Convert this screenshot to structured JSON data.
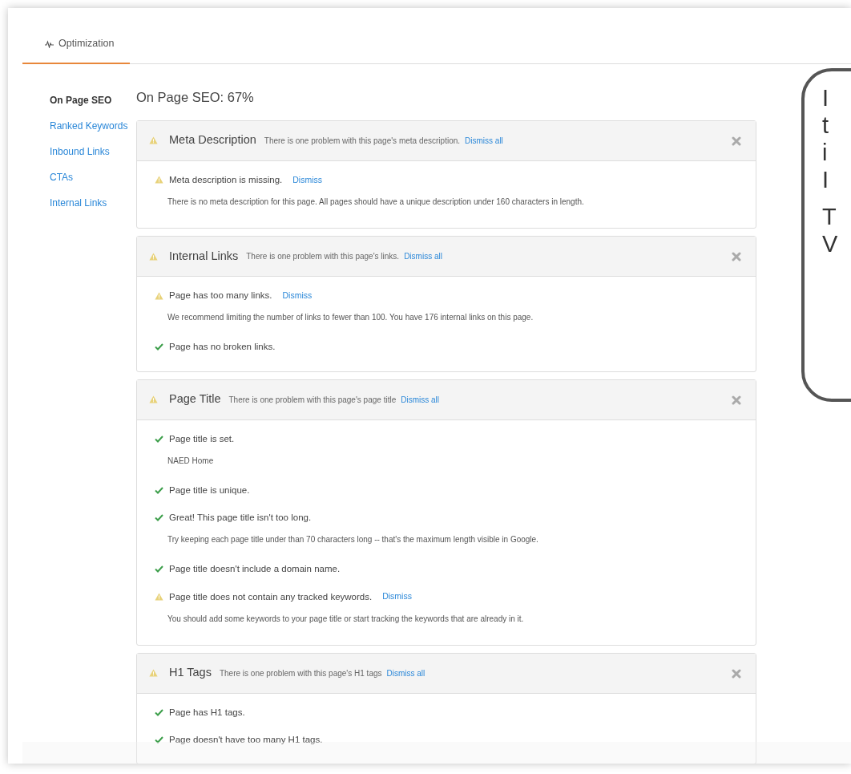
{
  "tabs": [
    {
      "label": "Optimization",
      "selected": true
    }
  ],
  "sidebar": {
    "items": [
      {
        "label": "On Page SEO",
        "selected": true
      },
      {
        "label": "Ranked Keywords",
        "selected": false
      },
      {
        "label": "Inbound Links",
        "selected": false
      },
      {
        "label": "CTAs",
        "selected": false
      },
      {
        "label": "Internal Links",
        "selected": false
      }
    ]
  },
  "heading": "On Page SEO: 67%",
  "sections": [
    {
      "title": "Meta Description",
      "summary": "There is one problem with this page's meta description.",
      "action": "Dismiss all",
      "items": [
        {
          "kind": "warning",
          "text": "Meta description is missing.",
          "action": "Dismiss",
          "detail": "There is no meta description for this page. All pages should have a unique description under 160 characters in length."
        }
      ]
    },
    {
      "title": "Internal Links",
      "summary": "There is one problem with this page's links.",
      "action": "Dismiss all",
      "items": [
        {
          "kind": "warning",
          "text": "Page has too many links.",
          "action": "Dismiss",
          "detail": "We recommend limiting the number of links to fewer than 100. You have 176 internal links on this page."
        },
        {
          "kind": "pass",
          "text": "Page has no broken links."
        }
      ]
    },
    {
      "title": "Page Title",
      "summary": "There is one problem with this page's page title",
      "action": "Dismiss all",
      "items": [
        {
          "kind": "pass",
          "text": "Page title is set.",
          "detail": "NAED Home"
        },
        {
          "kind": "pass",
          "text": "Page title is unique."
        },
        {
          "kind": "pass",
          "text": "Great! This page title isn't too long.",
          "detail": "Try keeping each page title under than 70 characters long -- that's the maximum length visible in Google."
        },
        {
          "kind": "pass",
          "text": "Page title doesn't include a domain name."
        },
        {
          "kind": "warning",
          "text": "Page title does not contain any tracked keywords.",
          "action": "Dismiss",
          "detail": "You should add some keywords to your page title or start tracking the keywords that are already in it."
        }
      ]
    },
    {
      "title": "H1 Tags",
      "summary": "There is one problem with this page's H1 tags",
      "action": "Dismiss all",
      "items": [
        {
          "kind": "pass",
          "text": "Page has H1 tags."
        },
        {
          "kind": "pass",
          "text": "Page doesn't have too many H1 tags."
        }
      ]
    }
  ],
  "callout": {
    "lines": [
      "I",
      "t",
      "i",
      "I",
      "T",
      "V"
    ]
  }
}
